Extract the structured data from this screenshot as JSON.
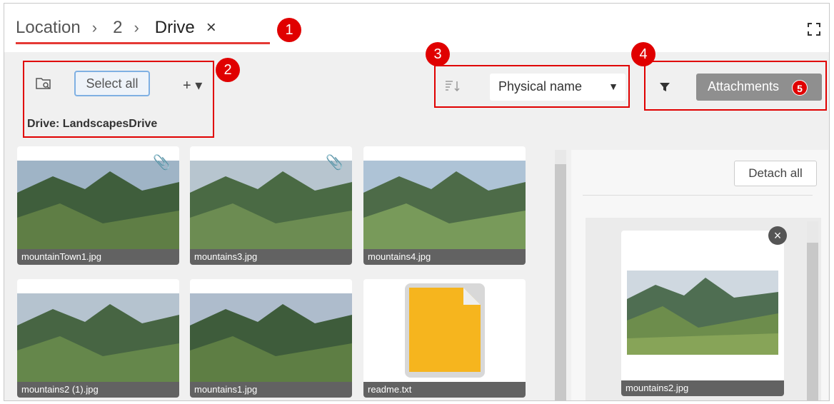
{
  "breadcrumb": {
    "items": [
      "Location",
      "2",
      "Drive"
    ],
    "separator": "›"
  },
  "close_glyph": "×",
  "callouts": [
    "1",
    "2",
    "3",
    "4"
  ],
  "toolbar": {
    "select_all": "Select all",
    "add_glyph": "+ ▾",
    "drive_label": "Drive:  LandscapesDrive",
    "sort_value": "Physical name",
    "attachments_label": "Attachments",
    "attachments_count": "5"
  },
  "files": [
    {
      "name": "mountainTown1.jpg",
      "attached": true,
      "kind": "image"
    },
    {
      "name": "mountains3.jpg",
      "attached": true,
      "kind": "image"
    },
    {
      "name": "mountains4.jpg",
      "attached": false,
      "kind": "image"
    },
    {
      "name": "mountains2 (1).jpg",
      "attached": false,
      "kind": "image"
    },
    {
      "name": "mountains1.jpg",
      "attached": false,
      "kind": "image"
    },
    {
      "name": "readme.txt",
      "attached": false,
      "kind": "text"
    }
  ],
  "attachments_panel": {
    "detach_all": "Detach all",
    "items": [
      {
        "name": "mountains2.jpg"
      }
    ]
  },
  "colors": {
    "highlight": "#e00000",
    "accent_button": "#8f8f8f"
  },
  "icons": [
    "fullscreen-icon",
    "folder-search-icon",
    "sort-icon",
    "filter-icon",
    "paperclip-icon",
    "close-icon"
  ]
}
